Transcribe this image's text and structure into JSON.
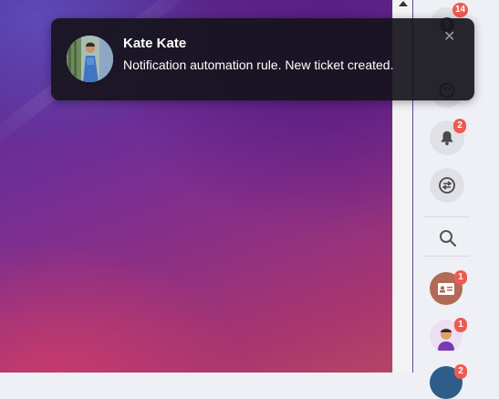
{
  "notification": {
    "sender": "Kate Kate",
    "message": "Notification automation rule. New ticket created.",
    "close_icon": "close-icon"
  },
  "rail": {
    "help_badge": "14",
    "alerts_badge": "2",
    "contacts_badge": "1",
    "user_badge": "1",
    "bottom_badge": "2"
  },
  "colors": {
    "badge": "#ee5a52",
    "toast_bg": "#16141c",
    "rail_bg": "#eef0f5"
  }
}
